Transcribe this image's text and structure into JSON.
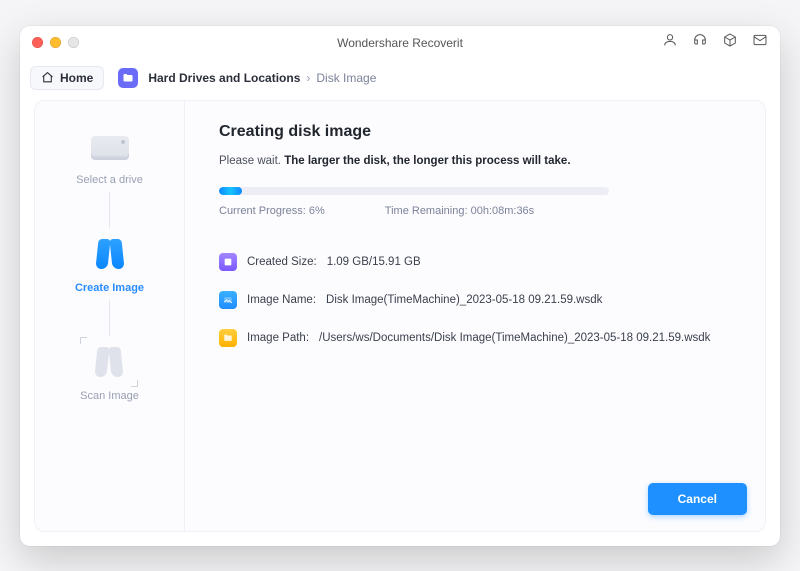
{
  "window": {
    "title": "Wondershare Recoverit"
  },
  "header": {
    "home_label": "Home",
    "breadcrumb": {
      "root": "Hard Drives and Locations",
      "leaf": "Disk Image"
    }
  },
  "stepper": {
    "step1": "Select a drive",
    "step2": "Create Image",
    "step3": "Scan Image"
  },
  "main": {
    "title": "Creating disk image",
    "wait_prefix": "Please wait.",
    "wait_bold": "The larger the disk, the longer this process will take.",
    "progress_percent": 6,
    "progress_label": "Current Progress:",
    "progress_value": "6%",
    "time_label": "Time Remaining:",
    "time_value": "00h:08m:36s",
    "info": {
      "size_label": "Created Size:",
      "size_value": "1.09 GB/15.91 GB",
      "name_label": "Image Name:",
      "name_value": "Disk Image(TimeMachine)_2023-05-18 09.21.59.wsdk",
      "path_label": "Image Path:",
      "path_value": "/Users/ws/Documents/Disk Image(TimeMachine)_2023-05-18 09.21.59.wsdk"
    }
  },
  "buttons": {
    "cancel": "Cancel"
  }
}
